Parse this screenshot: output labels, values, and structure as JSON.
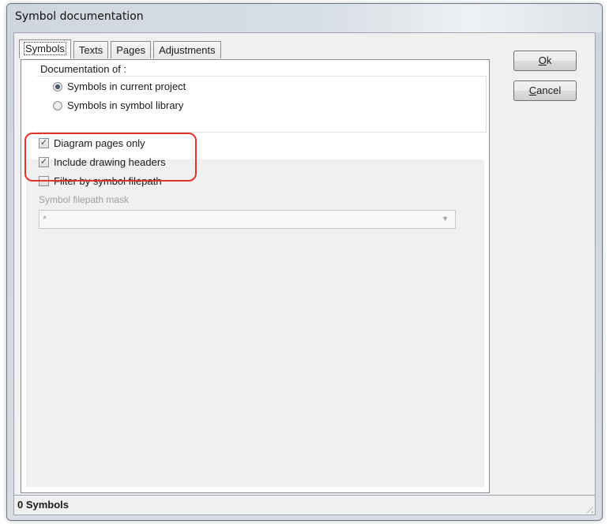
{
  "window": {
    "title": "Symbol documentation"
  },
  "tabs": [
    {
      "label": "Symbols",
      "active": true
    },
    {
      "label": "Texts",
      "active": false
    },
    {
      "label": "Pages",
      "active": false
    },
    {
      "label": "Adjustments",
      "active": false
    }
  ],
  "documentation": {
    "group_label": "Documentation of :",
    "options": [
      {
        "label": "Symbols in current project",
        "selected": true
      },
      {
        "label": "Symbols in symbol library",
        "selected": false
      }
    ]
  },
  "options": {
    "diagram_pages_only": {
      "label": "Diagram pages only",
      "checked": true
    },
    "include_drawing_headers": {
      "label": "Include drawing headers",
      "checked": true
    },
    "filter_by_symbol_filepath": {
      "label": "Filter by symbol filepath",
      "checked": false
    }
  },
  "filepath_mask": {
    "label": "Symbol filepath mask",
    "value": "*",
    "enabled": false
  },
  "buttons": {
    "ok_mnemonic": "O",
    "ok_rest": "k",
    "cancel_mnemonic": "C",
    "cancel_rest": "ancel"
  },
  "status": {
    "text": "0 Symbols"
  },
  "colors": {
    "highlight": "#e2342c"
  }
}
